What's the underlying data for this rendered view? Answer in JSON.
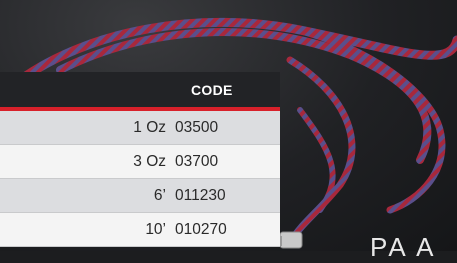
{
  "table": {
    "header": {
      "code_label": "CODE"
    },
    "rows": [
      {
        "size": "1 Oz",
        "code": "03500"
      },
      {
        "size": "3 Oz",
        "code": "03700"
      },
      {
        "size": "6’",
        "code": "011230"
      },
      {
        "size": "10’",
        "code": "010270"
      }
    ]
  },
  "overlay_text": "PA A",
  "colors": {
    "accent": "#d8202a",
    "row_alt": "#dcdde0",
    "row": "#f4f4f4",
    "header_bg": "#222326"
  }
}
